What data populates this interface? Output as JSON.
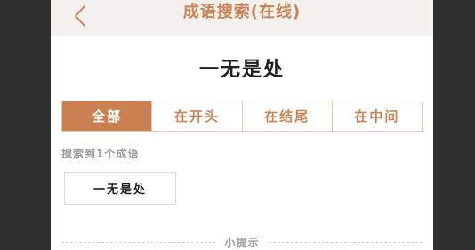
{
  "header": {
    "title": "成语搜索(在线)",
    "back_icon": "chevron-left-icon"
  },
  "query": "一无是处",
  "tabs": [
    {
      "label": "全部",
      "active": true
    },
    {
      "label": "在开头",
      "active": false
    },
    {
      "label": "在结尾",
      "active": false
    },
    {
      "label": "在中间",
      "active": false
    }
  ],
  "results": {
    "count_text": "搜索到1个成语",
    "items": [
      "一无是处"
    ]
  },
  "tip": {
    "label": "小提示"
  },
  "colors": {
    "accent": "#cc7f50",
    "header_bg": "#f3f0ed",
    "tab_border": "#e3cbb8",
    "outside_bg": "#2f2f2f"
  }
}
